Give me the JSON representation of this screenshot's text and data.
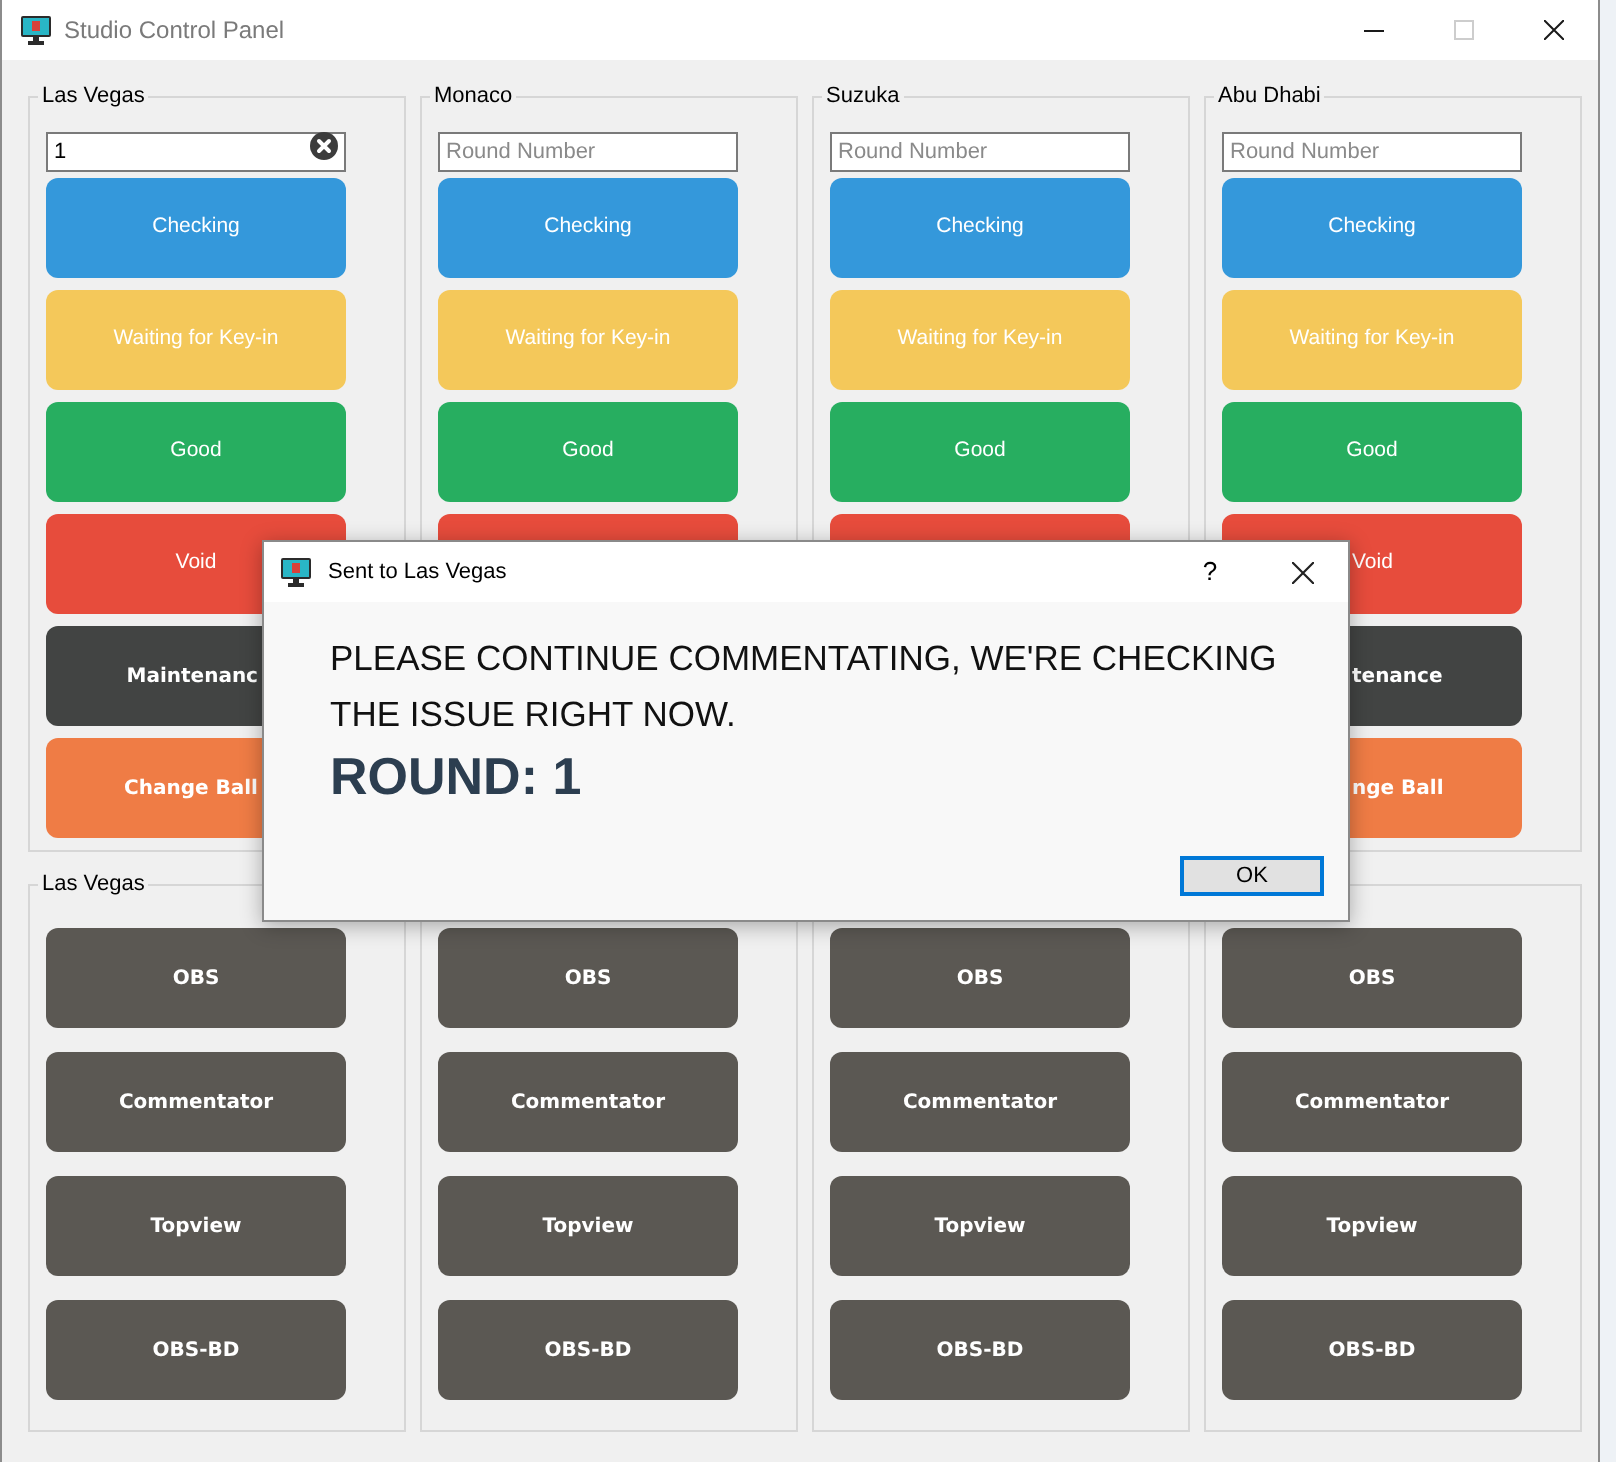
{
  "window": {
    "title": "Studio Control Panel",
    "controls": [
      {
        "kind": "minimize",
        "disabled": false
      },
      {
        "kind": "maximize",
        "disabled": true
      },
      {
        "kind": "close",
        "disabled": false
      }
    ]
  },
  "top_panels": [
    {
      "title": "Las Vegas",
      "round_field": {
        "value": "1"
      },
      "buttons": [
        {
          "kind": "checking",
          "label": "Checking"
        },
        {
          "kind": "waiting",
          "label": "Waiting for Key-in"
        },
        {
          "kind": "good",
          "label": "Good"
        },
        {
          "kind": "void",
          "label": "Void"
        },
        {
          "kind": "maintenance",
          "label": "Maintenanc",
          "covered_right": true
        },
        {
          "kind": "change_ball",
          "label": "Change Ball",
          "covered_right": true
        }
      ]
    },
    {
      "title": "Monaco",
      "round_field": {
        "placeholder": "Round Number"
      },
      "buttons": [
        {
          "kind": "checking",
          "label": "Checking"
        },
        {
          "kind": "waiting",
          "label": "Waiting for Key-in"
        },
        {
          "kind": "good",
          "label": "Good"
        },
        {
          "kind": "void"
        }
      ]
    },
    {
      "title": "Suzuka",
      "round_field": {
        "placeholder": "Round Number"
      },
      "buttons": [
        {
          "kind": "checking",
          "label": "Checking"
        },
        {
          "kind": "waiting",
          "label": "Waiting for Key-in"
        },
        {
          "kind": "good",
          "label": "Good"
        },
        {
          "kind": "void"
        }
      ]
    },
    {
      "title": "Abu Dhabi",
      "round_field": {
        "placeholder": "Round Number"
      },
      "buttons": [
        {
          "kind": "checking",
          "label": "Checking"
        },
        {
          "kind": "waiting",
          "label": "Waiting for Key-in"
        },
        {
          "kind": "good",
          "label": "Good"
        },
        {
          "kind": "void",
          "label": "Void",
          "covered_left": true
        },
        {
          "kind": "maintenance",
          "label": "tenance",
          "covered_left": true
        },
        {
          "kind": "change_ball",
          "label": "nge Ball",
          "covered_left": true
        }
      ]
    }
  ],
  "bottom_panels": [
    {
      "title": "Las Vegas",
      "buttons": [
        {
          "label": "OBS"
        },
        {
          "label": "Commentator"
        },
        {
          "label": "Topview"
        },
        {
          "label": "OBS-BD"
        }
      ]
    },
    {
      "buttons": [
        {
          "label": "OBS"
        },
        {
          "label": "Commentator"
        },
        {
          "label": "Topview"
        },
        {
          "label": "OBS-BD"
        }
      ]
    },
    {
      "buttons": [
        {
          "label": "OBS"
        },
        {
          "label": "Commentator"
        },
        {
          "label": "Topview"
        },
        {
          "label": "OBS-BD"
        }
      ]
    },
    {
      "buttons": [
        {
          "label": "OBS"
        },
        {
          "label": "Commentator"
        },
        {
          "label": "Topview"
        },
        {
          "label": "OBS-BD"
        }
      ]
    }
  ],
  "dialog": {
    "title": "Sent to Las Vegas",
    "help": "?",
    "message": "PLEASE CONTINUE COMMENTATING, WE'RE CHECKING THE ISSUE RIGHT NOW.",
    "round": "ROUND: 1",
    "buttons": [
      {
        "label": "OK",
        "default": true
      }
    ]
  }
}
